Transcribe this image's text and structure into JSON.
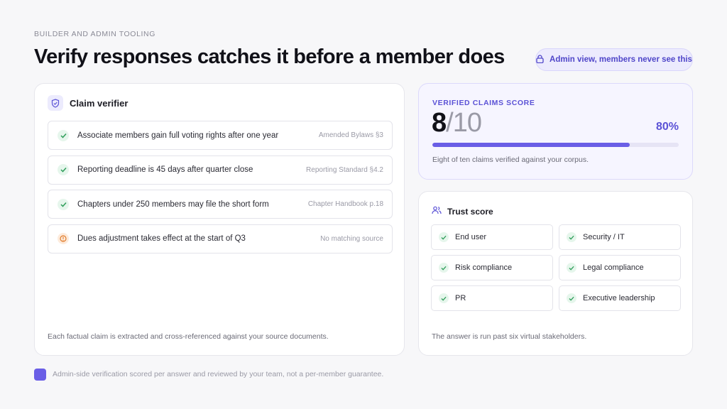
{
  "header": {
    "eyebrow": "BUILDER AND ADMIN TOOLING",
    "title": "Verify responses catches it before a member does",
    "admin_pill": "Admin view, members never see this",
    "admin_pill_icon": "lock-icon"
  },
  "claim_verifier": {
    "title": "Claim verifier",
    "icon": "shield-check-icon",
    "claims": [
      {
        "text": "Associate members gain full voting rights after one year",
        "source": "Amended Bylaws §3",
        "status": "verified"
      },
      {
        "text": "Reporting deadline is 45 days after quarter close",
        "source": "Reporting Standard §4.2",
        "status": "verified"
      },
      {
        "text": "Chapters under 250 members may file the short form",
        "source": "Chapter Handbook p.18",
        "status": "verified"
      },
      {
        "text": "Dues adjustment takes effect at the start of Q3",
        "source": "No matching source",
        "status": "unverified"
      }
    ],
    "footer": "Each factual claim is extracted and cross-referenced against your source documents."
  },
  "score": {
    "label": "VERIFIED CLAIMS SCORE",
    "numerator": "8",
    "denominator": "/10",
    "percent": "80%",
    "progress": 0.8,
    "note": "Eight of ten claims verified against your corpus."
  },
  "trust": {
    "title": "Trust score",
    "icon": "users-icon",
    "stakeholders": [
      {
        "label": "End user"
      },
      {
        "label": "Security / IT"
      },
      {
        "label": "Risk compliance"
      },
      {
        "label": "Legal compliance"
      },
      {
        "label": "PR"
      },
      {
        "label": "Executive leadership"
      }
    ],
    "footer": "The answer is run past six virtual stakeholders."
  },
  "disclaimer": "Admin-side verification scored per answer and reviewed by your team, not a per-member guarantee.",
  "colors": {
    "accent": "#6a5ee6",
    "verified": "#2f9e5a",
    "warning": "#e07b2a"
  }
}
